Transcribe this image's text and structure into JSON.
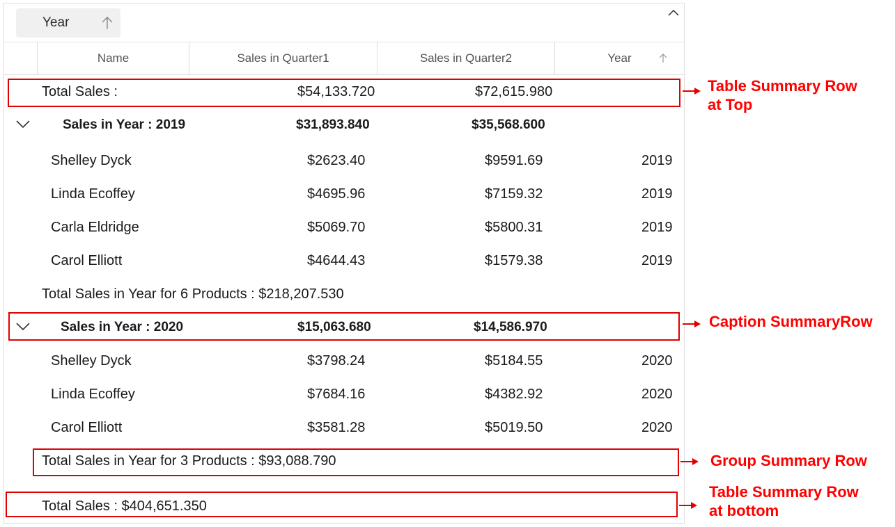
{
  "group_panel": {
    "chip_label": "Year"
  },
  "columns": [
    "Name",
    "Sales in Quarter1",
    "Sales in Quarter2",
    "Year"
  ],
  "table_summary_top": {
    "label": "Total Sales :",
    "q1": "$54,133.720",
    "q2": "$72,615.980"
  },
  "groups": [
    {
      "caption": "Sales in Year : 2019",
      "q1": "$31,893.840",
      "q2": "$35,568.600",
      "rows": [
        {
          "name": "Shelley Dyck",
          "q1": "$2623.40",
          "q2": "$9591.69",
          "year": "2019"
        },
        {
          "name": "Linda Ecoffey",
          "q1": "$4695.96",
          "q2": "$7159.32",
          "year": "2019"
        },
        {
          "name": "Carla Eldridge",
          "q1": "$5069.70",
          "q2": "$5800.31",
          "year": "2019"
        },
        {
          "name": "Carol Elliott",
          "q1": "$4644.43",
          "q2": "$1579.38",
          "year": "2019"
        }
      ],
      "summary": "Total Sales in Year for 6 Products : $218,207.530"
    },
    {
      "caption": "Sales in Year : 2020",
      "q1": "$15,063.680",
      "q2": "$14,586.970",
      "rows": [
        {
          "name": "Shelley Dyck",
          "q1": "$3798.24",
          "q2": "$5184.55",
          "year": "2020"
        },
        {
          "name": "Linda Ecoffey",
          "q1": "$7684.16",
          "q2": "$4382.92",
          "year": "2020"
        },
        {
          "name": "Carol Elliott",
          "q1": "$3581.28",
          "q2": "$5019.50",
          "year": "2020"
        }
      ],
      "summary": "Total Sales in Year for 3 Products : $93,088.790"
    }
  ],
  "table_summary_bottom": {
    "label": "Total Sales : $404,651.350"
  },
  "annotations": {
    "top_line1": "Table Summary Row",
    "top_line2": "at Top",
    "caption": "Caption SummaryRow",
    "group": "Group Summary Row",
    "bottom_line1": "Table Summary Row",
    "bottom_line2": "at bottom",
    "color": "#ff0000"
  }
}
